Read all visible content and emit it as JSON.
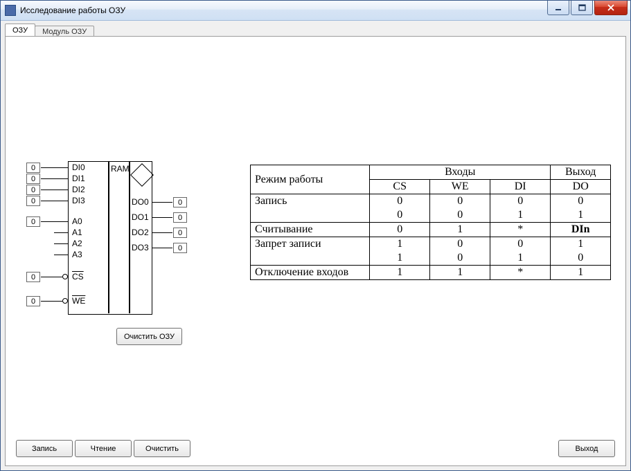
{
  "window": {
    "title": "Исследование работы ОЗУ"
  },
  "tabs": [
    {
      "label": "ОЗУ",
      "active": true
    },
    {
      "label": "Модуль ОЗУ",
      "active": false
    }
  ],
  "ram": {
    "title": "RAM",
    "di_pins": [
      {
        "label": "DI0",
        "value": "0"
      },
      {
        "label": "DI1",
        "value": "0"
      },
      {
        "label": "DI2",
        "value": "0"
      },
      {
        "label": "DI3",
        "value": "0"
      }
    ],
    "addr_pins": [
      {
        "label": "A0",
        "value": "0"
      },
      {
        "label": "A1",
        "value": ""
      },
      {
        "label": "A2",
        "value": ""
      },
      {
        "label": "A3",
        "value": ""
      }
    ],
    "cs": {
      "label": "CS",
      "value": "0"
    },
    "we": {
      "label": "WE",
      "value": "0"
    },
    "do_pins": [
      {
        "label": "DO0",
        "value": "0"
      },
      {
        "label": "DO1",
        "value": "0"
      },
      {
        "label": "DO2",
        "value": "0"
      },
      {
        "label": "DO3",
        "value": "0"
      }
    ]
  },
  "buttons": {
    "clear_ram": "Очистить ОЗУ",
    "write": "Запись",
    "read": "Чтение",
    "clear": "Очистить",
    "exit": "Выход"
  },
  "table": {
    "headers": {
      "mode": "Режим работы",
      "inputs": "Входы",
      "output": "Выход",
      "cs": "CS",
      "we": "WE",
      "di": "DI",
      "do": "DO"
    },
    "rows": [
      {
        "mode": "Запись",
        "vals": [
          [
            "0",
            "0",
            "0",
            "0"
          ],
          [
            "0",
            "0",
            "1",
            "1"
          ]
        ]
      },
      {
        "mode": "Считывание",
        "vals": [
          [
            "0",
            "1",
            "*",
            "DIn"
          ]
        ],
        "do_bold": true
      },
      {
        "mode": "Запрет записи",
        "vals": [
          [
            "1",
            "0",
            "0",
            "1"
          ],
          [
            "1",
            "0",
            "1",
            "0"
          ]
        ]
      },
      {
        "mode": "Отключение входов",
        "vals": [
          [
            "1",
            "1",
            "*",
            "1"
          ]
        ]
      }
    ]
  }
}
